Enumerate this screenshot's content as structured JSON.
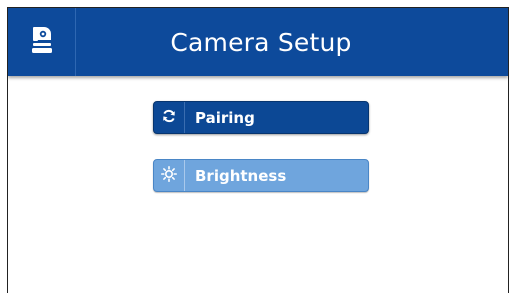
{
  "header": {
    "title": "Camera Setup",
    "icon": "camera-icon",
    "color": "#0d4a9b"
  },
  "menu": {
    "items": [
      {
        "label": "Pairing",
        "icon": "refresh-icon",
        "color": "#0c4895"
      },
      {
        "label": "Brightness",
        "icon": "sun-icon",
        "color": "#6fa5dd"
      }
    ]
  }
}
